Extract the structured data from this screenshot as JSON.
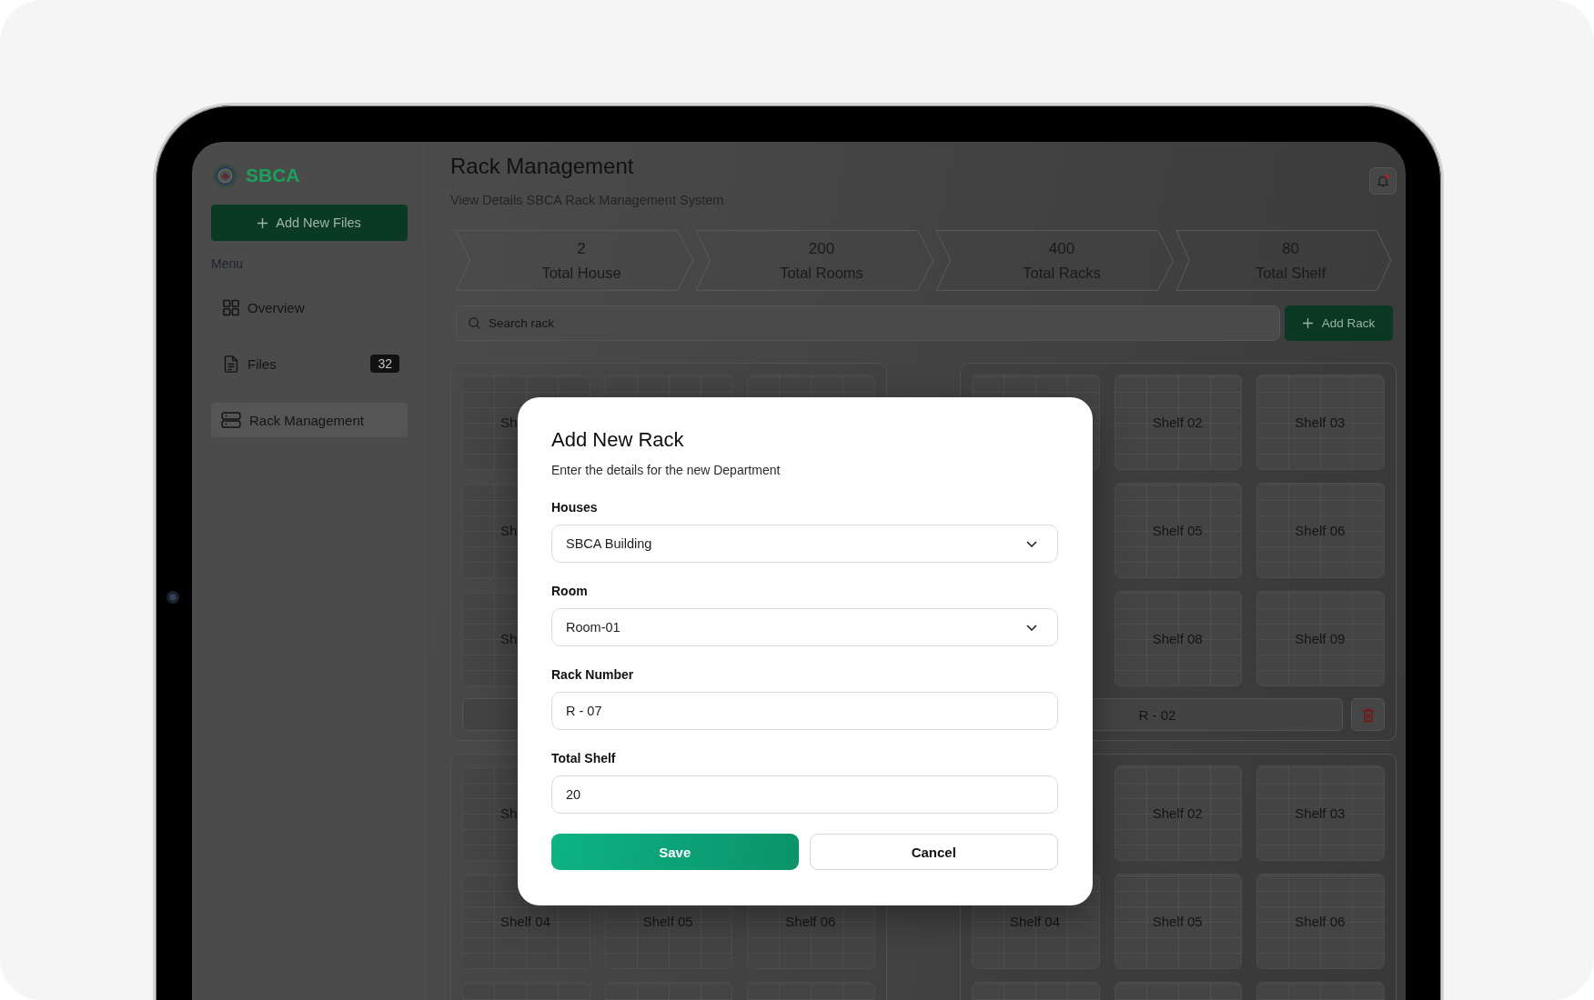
{
  "sidebar": {
    "brand": "SBCA",
    "add_button": "Add New Files",
    "menu_heading": "Menu",
    "items": [
      {
        "label": "Overview",
        "selected": false
      },
      {
        "label": "Files",
        "selected": false,
        "badge": "32"
      },
      {
        "label": "Rack Management",
        "selected": true
      }
    ]
  },
  "header": {
    "title": "Rack Management",
    "subtitle": "View Details SBCA Rack Management System",
    "unread": true
  },
  "stats": [
    {
      "value": "2",
      "label": "Total House"
    },
    {
      "value": "200",
      "label": "Total Rooms"
    },
    {
      "value": "400",
      "label": "Total Racks"
    },
    {
      "value": "80",
      "label": "Total Shelf"
    }
  ],
  "toolbar": {
    "search_placeholder": "Search rack",
    "add_button": "Add Rack"
  },
  "racks": [
    {
      "shelves": [
        {
          "kind": "shelf",
          "label": "Sh"
        },
        {
          "kind": "shelf"
        },
        {
          "kind": "shelf"
        },
        {
          "kind": "shelf",
          "label": "Sh"
        },
        {
          "kind": "covered"
        },
        {
          "kind": "covered"
        },
        {
          "kind": "shelf",
          "label": "Sh"
        },
        {
          "kind": "covered"
        },
        {
          "kind": "covered"
        }
      ],
      "bar": {
        "delete_button": false
      }
    },
    {
      "shelves": [
        {
          "kind": "shelf"
        },
        {
          "kind": "shelf",
          "label": "Shelf 02"
        },
        {
          "kind": "shelf",
          "label": "Shelf 03"
        },
        {
          "kind": "covered"
        },
        {
          "kind": "shelf",
          "label": "Shelf 05"
        },
        {
          "kind": "shelf",
          "label": "Shelf 06"
        },
        {
          "kind": "covered"
        },
        {
          "kind": "shelf",
          "label": "Shelf 08"
        },
        {
          "kind": "shelf",
          "label": "Shelf 09"
        }
      ],
      "bar": {
        "label": "R - 02",
        "delete_button": true
      }
    },
    {
      "shelves": [
        {
          "kind": "shelf",
          "label": "Sh"
        },
        {
          "kind": "covered"
        },
        {
          "kind": "covered"
        },
        {
          "kind": "shelf",
          "label": "Shelf 04"
        },
        {
          "kind": "shelf",
          "label": "Shelf 05"
        },
        {
          "kind": "shelf",
          "label": "Shelf 06"
        },
        {
          "kind": "shelf"
        },
        {
          "kind": "shelf"
        },
        {
          "kind": "shelf"
        }
      ]
    },
    {
      "shelves": [
        {
          "kind": "covered"
        },
        {
          "kind": "shelf",
          "label": "Shelf 02"
        },
        {
          "kind": "shelf",
          "label": "Shelf 03"
        },
        {
          "kind": "shelf",
          "label": "Shelf 04"
        },
        {
          "kind": "shelf",
          "label": "Shelf 05"
        },
        {
          "kind": "shelf",
          "label": "Shelf 06"
        },
        {
          "kind": "shelf"
        },
        {
          "kind": "shelf"
        },
        {
          "kind": "shelf"
        }
      ]
    }
  ],
  "dialog": {
    "title": "Add New Rack",
    "subtitle": "Enter the details for the new Department",
    "fields": [
      {
        "label": "Houses",
        "kind": "select",
        "value": "SBCA Building"
      },
      {
        "label": "Room",
        "kind": "select",
        "value": "Room-01"
      },
      {
        "label": "Rack Number",
        "kind": "text",
        "value": "R - 07"
      },
      {
        "label": "Total Shelf",
        "kind": "text",
        "value": "20"
      }
    ],
    "buttons": [
      {
        "label": "Save",
        "kind": "primary"
      },
      {
        "label": "Cancel",
        "kind": "secondary"
      }
    ]
  }
}
